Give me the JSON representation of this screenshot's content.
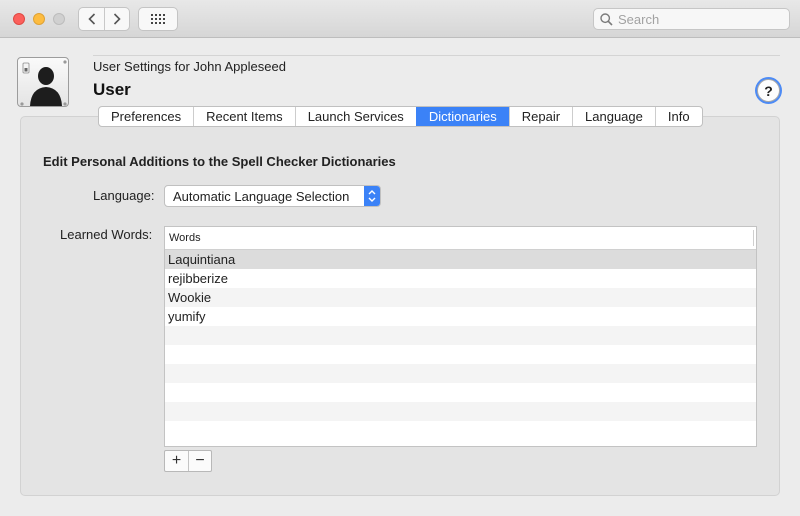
{
  "window": {
    "search_placeholder": "Search"
  },
  "header": {
    "subtitle": "User Settings for John Appleseed",
    "title": "User",
    "help_label": "?"
  },
  "tabs": [
    {
      "label": "Preferences",
      "active": false
    },
    {
      "label": "Recent Items",
      "active": false
    },
    {
      "label": "Launch Services",
      "active": false
    },
    {
      "label": "Dictionaries",
      "active": true
    },
    {
      "label": "Repair",
      "active": false
    },
    {
      "label": "Language",
      "active": false
    },
    {
      "label": "Info",
      "active": false
    }
  ],
  "dictionaries": {
    "section_title": "Edit Personal Additions to the Spell Checker Dictionaries",
    "language_label": "Language:",
    "language_value": "Automatic Language Selection",
    "learned_label": "Learned Words:",
    "column_header": "Words",
    "words": [
      "Laquintiana",
      "rejibberize",
      "Wookie",
      "yumify"
    ],
    "selected_index": 0,
    "add_label": "+",
    "remove_label": "−"
  },
  "colors": {
    "accent": "#3b82f7",
    "close": "#fc605c",
    "minimize": "#fdbc40"
  }
}
